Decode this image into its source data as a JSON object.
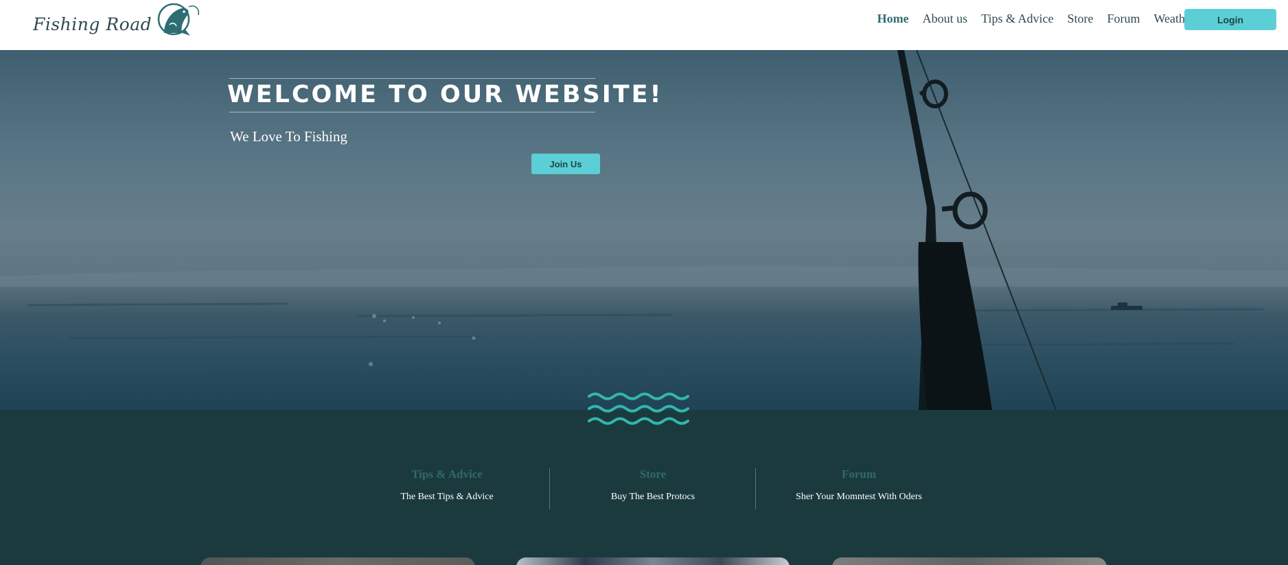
{
  "header": {
    "logo_text": "Fishing Road",
    "logo_icon": "fish-icon",
    "nav": [
      {
        "label": "Home",
        "active": true
      },
      {
        "label": "About us",
        "active": false
      },
      {
        "label": "Tips & Advice",
        "active": false
      },
      {
        "label": "Store",
        "active": false
      },
      {
        "label": "Forum",
        "active": false
      },
      {
        "label": "Weather",
        "active": false
      }
    ],
    "login_label": "Login"
  },
  "hero": {
    "title": "WELCOME TO OUR WEBSITE!",
    "subtitle": "We Love To Fishing",
    "join_label": "Join Us"
  },
  "decor": {
    "wave_icon": "waves-icon"
  },
  "features": [
    {
      "title": "Tips & Advice",
      "desc": "The Best Tips & Advice"
    },
    {
      "title": "Store",
      "desc": "Buy The Best Protocs"
    },
    {
      "title": "Forum",
      "desc": "Sher Your Momntest With Oders"
    }
  ],
  "colors": {
    "accent": "#5ccfd6",
    "dark_teal": "#1b3a3e",
    "feature_title": "#2f6a6f",
    "header_text": "#2d4a52"
  }
}
